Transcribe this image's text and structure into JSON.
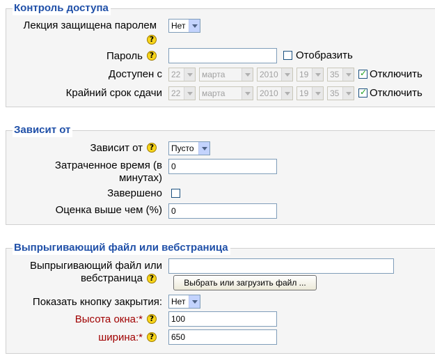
{
  "access": {
    "legend": "Контроль доступа",
    "password_protected": {
      "label": "Лекция защищена паролем",
      "value": "Нет"
    },
    "password": {
      "label": "Пароль",
      "value": "",
      "reveal_label": "Отобразить"
    },
    "available_from": {
      "label": "Доступен с",
      "day": "22",
      "month": "марта",
      "year": "2010",
      "hour": "19",
      "minute": "35",
      "disable_label": "Отключить"
    },
    "deadline": {
      "label": "Крайний срок сдачи",
      "day": "22",
      "month": "марта",
      "year": "2010",
      "hour": "19",
      "minute": "35",
      "disable_label": "Отключить"
    }
  },
  "depends": {
    "legend": "Зависит от",
    "depends_on": {
      "label": "Зависит от",
      "value": "Пусто"
    },
    "time_spent": {
      "label_line1": "Затраченное время (в",
      "label_line2": "минутах)",
      "value": "0"
    },
    "completed": {
      "label": "Завершено"
    },
    "grade_better": {
      "label": "Оценка выше чем (%)",
      "value": "0"
    }
  },
  "popup": {
    "legend": "Выпрыгивающий файл или вебстраница",
    "file": {
      "label_line1": "Выпрыгивающий файл или",
      "label_line2": "вебстраница",
      "value": "",
      "choose_button": "Выбрать или загрузить файл ..."
    },
    "show_close": {
      "label": "Показать кнопку закрытия:",
      "value": "Нет"
    },
    "height": {
      "label": "Высота окна:",
      "required": "*",
      "value": "100"
    },
    "width": {
      "label": "ширина:",
      "required": "*",
      "value": "650"
    }
  },
  "icons": {
    "help": "help-icon",
    "help_glyph": "?"
  }
}
